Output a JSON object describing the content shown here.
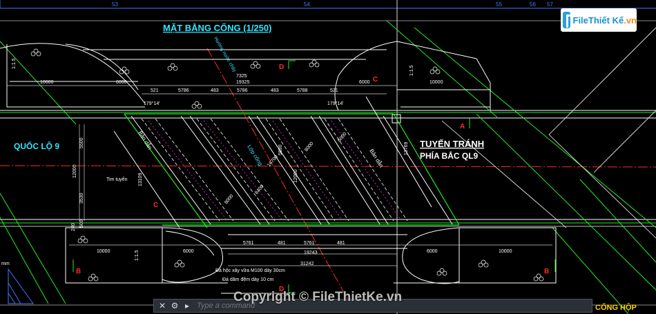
{
  "drawing": {
    "title": "MẶT BẰNG CỐNG (1/250)",
    "ruler": [
      "53",
      "54",
      "55",
      "56",
      "57"
    ],
    "road_label": "QUỐC LỘ 9",
    "bypass_line1": "TUYẾN TRÁNH",
    "bypass_line2": "PHÍA BẮC QL9",
    "tim_tuyen": "Tim tuyến",
    "dim_top": [
      "10000",
      "6000",
      "521",
      "5786",
      "483",
      "5786",
      "483",
      "5788",
      "521",
      "6000",
      "10000"
    ],
    "dim_top_total": "19325",
    "dim_top_small": "7325",
    "dim_bottom": [
      "10000",
      "6000",
      "5761",
      "481",
      "5761",
      "481",
      "6000",
      "10000"
    ],
    "dim_bottom_total1": "19243",
    "dim_bottom_total2": "31242",
    "dim_left": [
      "1:1.5",
      "5500",
      "12000",
      "3530",
      "500",
      "240",
      "1:1.5"
    ],
    "angle_labels": [
      "179°14'",
      "179°14'"
    ],
    "dim_diag": [
      "13109",
      "13769",
      "8000",
      "8400",
      "8000",
      "6000",
      "5890",
      "16700",
      "12000"
    ],
    "section_labels": [
      "D",
      "D",
      "C",
      "C",
      "A",
      "B",
      "B"
    ],
    "mid_labels": [
      "Bản dẫn",
      "Bản dẫn",
      "Lớp cống",
      "Hướng nước chảy"
    ],
    "note1": "Đá hộc xây vữa M100 dày 30cm",
    "note2": "Đá dăm đệm dày 10 cm",
    "mm": "mm",
    "corner_text": "CỐNG HỘP"
  },
  "logo": {
    "part1": "File",
    "part2": "Thiết Kế",
    "part3": ".vn"
  },
  "command_line": {
    "placeholder": "Type a command"
  },
  "watermark": "Copyright © FileThietKe.vn",
  "colors": {
    "background": "#000000",
    "white": "#ffffff",
    "green": "#22ee22",
    "cyan": "#33e5ff",
    "red": "#ff2a2a",
    "magenta": "#ff44ff",
    "yellow": "#ffd400"
  }
}
